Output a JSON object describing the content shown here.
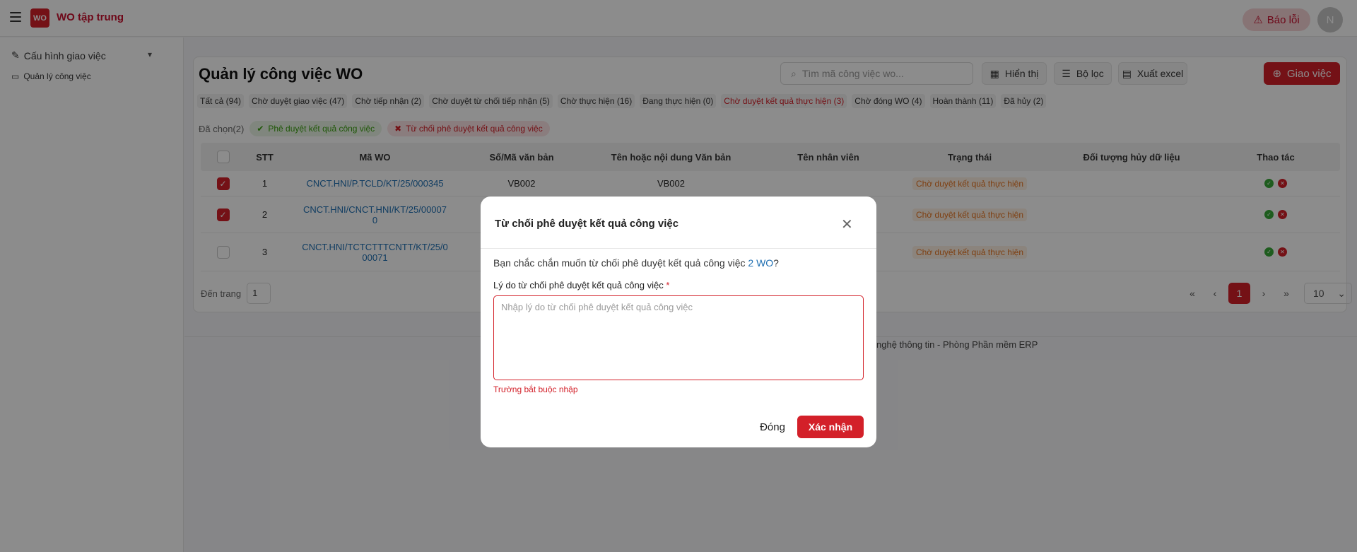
{
  "header": {
    "app_title": "WO tập trung",
    "logo_text": "WO",
    "report_label": "Báo lỗi",
    "avatar_letter": "N"
  },
  "sidebar": {
    "group_label": "Cấu hình giao việc",
    "item_label": "Quản lý công việc"
  },
  "page": {
    "title": "Quản lý công việc WO",
    "search_placeholder": "Tìm mã công việc wo...",
    "buttons": {
      "display": "Hiển thị",
      "filter": "Bộ lọc",
      "export": "Xuất excel",
      "assign": "Giao việc"
    },
    "tabs": [
      {
        "label": "Tất cả (94)",
        "active": false
      },
      {
        "label": "Chờ duyệt giao việc (47)",
        "active": false
      },
      {
        "label": "Chờ tiếp nhận (2)",
        "active": false
      },
      {
        "label": "Chờ duyệt từ chối tiếp nhận (5)",
        "active": false
      },
      {
        "label": "Chờ thực hiện (16)",
        "active": false
      },
      {
        "label": "Đang thực hiện (0)",
        "active": false
      },
      {
        "label": "Chờ duyệt kết quả thực hiện (3)",
        "active": true
      },
      {
        "label": "Chờ đóng WO (4)",
        "active": false
      },
      {
        "label": "Hoàn thành (11)",
        "active": false
      },
      {
        "label": "Đã hủy (2)",
        "active": false
      }
    ],
    "selected_label": "Đã chọn(2)",
    "approve_chip": "Phê duyệt kết quả công việc",
    "reject_chip": "Từ chối phê duyệt kết quả công việc"
  },
  "table": {
    "columns": [
      "STT",
      "Mã WO",
      "Số/Mã văn bản",
      "Tên hoặc nội dung Văn bản",
      "Tên nhân viên",
      "Trạng thái",
      "Đối tượng hủy dữ liệu",
      "Thao tác"
    ],
    "rows": [
      {
        "checked": true,
        "stt": "1",
        "wo": "CNCT.HNI/P.TCLD/KT/25/000345",
        "wo2": "",
        "doc": "VB002",
        "name": "VB002",
        "employee": "",
        "status": "Chờ duyệt kết quả thực hiện",
        "object": ""
      },
      {
        "checked": true,
        "stt": "2",
        "wo": "CNCT.HNI/CNCT.HNI/KT/25/00007",
        "wo2": "0",
        "doc": "",
        "name": "",
        "employee": "",
        "status": "Chờ duyệt kết quả thực hiện",
        "object": ""
      },
      {
        "checked": false,
        "stt": "3",
        "wo": "CNCT.HNI/TCTCTTTCNTT/KT/25/0",
        "wo2": "00071",
        "doc": "",
        "name": "",
        "employee": "",
        "status": "Chờ duyệt kết quả thực hiện",
        "object": ""
      }
    ]
  },
  "pagination": {
    "goto_label": "Đến trang",
    "goto_value": "1",
    "current_page": "1",
    "page_size": "10"
  },
  "footer": {
    "text": "nghệ thông tin - Phòng Phần mềm ERP"
  },
  "modal": {
    "title": "Từ chối phê duyệt kết quả công việc",
    "question_prefix": "Bạn chắc chắn muốn từ chối phê duyệt kết quả công việc ",
    "question_count": "2 WO",
    "question_suffix": "?",
    "reason_label": "Lý do từ chối phê duyệt kết quả công việc",
    "required_mark": "*",
    "reason_placeholder": "Nhập lý do từ chối phê duyệt kết quả công việc",
    "error": "Trường bắt buộc nhập",
    "cancel_label": "Đóng",
    "confirm_label": "Xác nhận"
  },
  "colors": {
    "brand": "#d32029",
    "link": "#1f6fb2",
    "status": "#e6731f",
    "approve": "#38a838"
  }
}
